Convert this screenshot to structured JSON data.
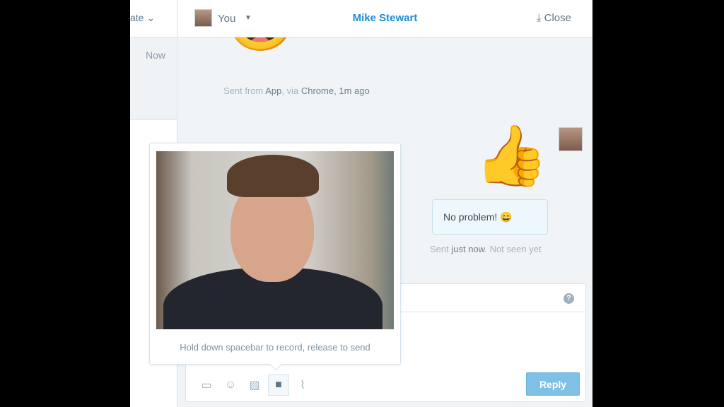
{
  "sidebar": {
    "header_label": "ate",
    "item_time": "Now"
  },
  "header": {
    "user_label": "You",
    "title": "Mike Stewart",
    "close_label": "Close"
  },
  "messages": [
    {
      "emoji": "😂",
      "meta_prefix": "Sent from ",
      "meta_app": "App",
      "meta_via": ", via ",
      "meta_browser": "Chrome",
      "meta_time": ", 1m ago"
    },
    {
      "emoji": "👍",
      "text": "No problem! 😄",
      "meta_prefix": "Sent ",
      "meta_time": "just now",
      "meta_status": ". Not seen yet"
    }
  ],
  "video_popup": {
    "hint": "Hold down spacebar to record, release to send"
  },
  "composer": {
    "help": "?",
    "reply_label": "Reply",
    "tools": [
      "inbox-icon",
      "emoji-icon",
      "image-icon",
      "video-icon",
      "attachment-icon"
    ]
  },
  "colors": {
    "accent": "#1e8dd2",
    "reply_button": "#7fc0e6"
  }
}
